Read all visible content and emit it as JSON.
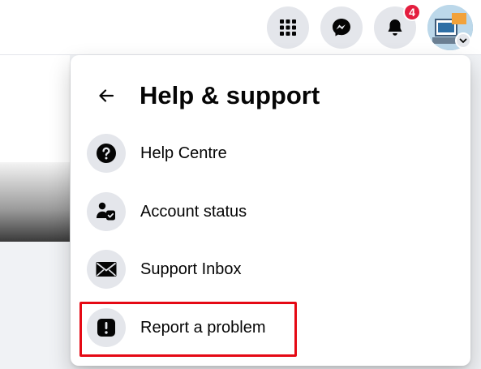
{
  "notifications": {
    "count": "4"
  },
  "panel": {
    "title": "Help & support",
    "items": [
      {
        "label": "Help Centre",
        "icon": "question-circle-icon"
      },
      {
        "label": "Account status",
        "icon": "account-status-icon"
      },
      {
        "label": "Support Inbox",
        "icon": "envelope-icon"
      },
      {
        "label": "Report a problem",
        "icon": "exclamation-icon"
      }
    ]
  },
  "colors": {
    "accent": "#e41e3f",
    "highlight": "#e50914",
    "icon_bg": "#e4e6eb",
    "text": "#050505"
  }
}
